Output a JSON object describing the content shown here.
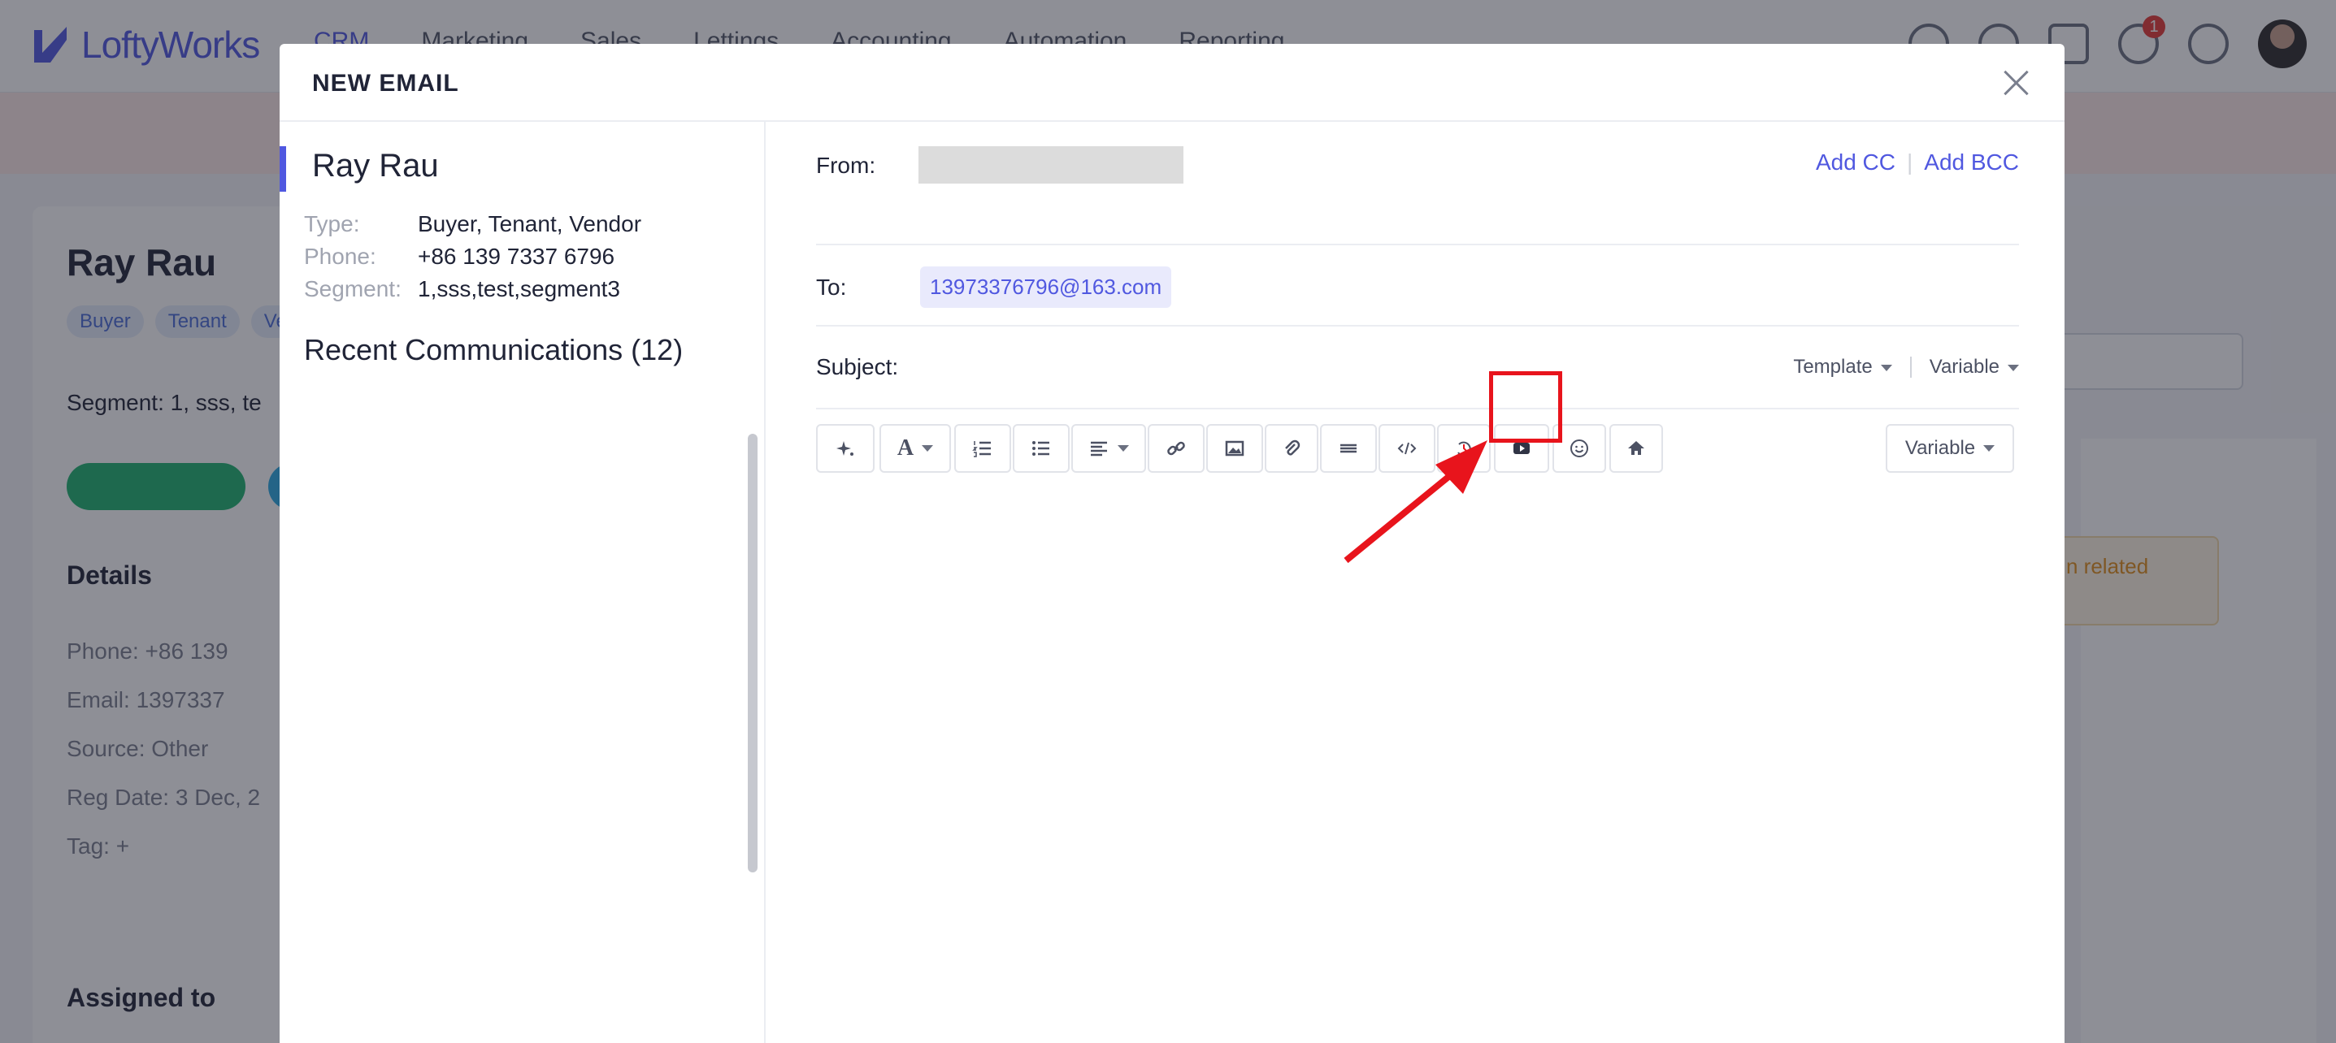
{
  "app": {
    "logo_text": "LoftyWorks",
    "nav": [
      "CRM",
      "Marketing",
      "Sales",
      "Lettings",
      "Accounting",
      "Automation",
      "Reporting"
    ],
    "notification_count": "1"
  },
  "background": {
    "contact_name": "Ray Rau",
    "tags": [
      "Buyer",
      "Tenant",
      "Ve"
    ],
    "segment": "Segment:  1, sss, te",
    "details_heading": "Details",
    "rows": [
      "Phone:  +86 139",
      "Email:  1397337",
      "Source:  Other",
      "Reg Date:  3 Dec, 2",
      "Tag:  +"
    ],
    "assigned_heading": "Assigned to",
    "warning_text": "n related"
  },
  "modal": {
    "title": "NEW EMAIL",
    "contact": {
      "name": "Ray Rau",
      "type_label": "Type:",
      "type_value": "Buyer, Tenant, Vendor",
      "phone_label": "Phone:",
      "phone_value": "+86 139 7337 6796",
      "segment_label": "Segment:",
      "segment_value": "1,sss,test,segment3",
      "recent_heading": "Recent Communications (12)"
    },
    "from_label": "From:",
    "add_cc": "Add CC",
    "add_bcc": "Add BCC",
    "to_label": "To:",
    "to_recipient": "13973376796@163.com",
    "subject_label": "Subject:",
    "template_label": "Template",
    "variable_label": "Variable",
    "toolbar_variable_label": "Variable",
    "toolbar_buttons": [
      "ai-sparkle",
      "font-color",
      "ordered-list",
      "bullet-list",
      "align",
      "link",
      "image",
      "attachment",
      "horizontal-rule",
      "code",
      "history",
      "video",
      "emoji",
      "home"
    ]
  },
  "annotation": {
    "highlight_color": "#e8141c"
  }
}
